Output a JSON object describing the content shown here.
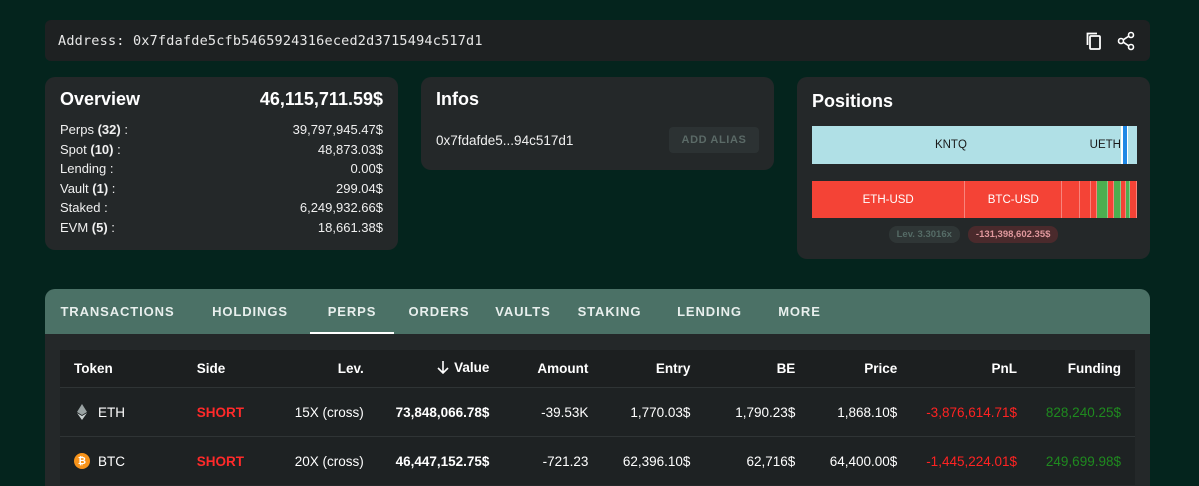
{
  "address_bar": {
    "text": "Address: 0x7fdafde5cfb5465924316eced2d3715494c517d1",
    "icons": [
      "copy-icon",
      "share-icon"
    ]
  },
  "overview": {
    "title": "Overview",
    "total": "46,115,711.59$",
    "rows": [
      {
        "label": "Perps",
        "count": "(32)",
        "suffix": " :",
        "value": "39,797,945.47$"
      },
      {
        "label": "Spot",
        "count": "(10)",
        "suffix": " :",
        "value": "48,873.03$"
      },
      {
        "label": "Lending :",
        "count": "",
        "suffix": "",
        "value": "0.00$"
      },
      {
        "label": "Vault",
        "count": "(1)",
        "suffix": " :",
        "value": "299.04$"
      },
      {
        "label": "Staked :",
        "count": "",
        "suffix": "",
        "value": "6,249,932.66$"
      },
      {
        "label": "EVM",
        "count": "(5)",
        "suffix": " :",
        "value": "18,661.38$"
      }
    ]
  },
  "infos": {
    "title": "Infos",
    "short_address": "0x7fdafde5...94c517d1",
    "alias_button": "ADD ALIAS"
  },
  "positions": {
    "title": "Positions",
    "spot_bar": [
      {
        "label": "KNTQ",
        "share": 0.855,
        "color": "#b0e0e6"
      },
      {
        "label": "UETH",
        "share": 0.095,
        "color": "#b0e0e6"
      },
      {
        "label": "",
        "share": 0.006,
        "color": "#ffffff"
      },
      {
        "label": "",
        "share": 0.012,
        "color": "#1e88e5"
      },
      {
        "label": "",
        "share": 0.004,
        "color": "#ffffff"
      },
      {
        "label": "",
        "share": 0.028,
        "color": "#b0e0e6"
      }
    ],
    "perp_bar": [
      {
        "label": "ETH-USD",
        "share": 0.472,
        "color": "#f44336"
      },
      {
        "label": "BTC-USD",
        "share": 0.298,
        "color": "#f44336"
      },
      {
        "label": "",
        "share": 0.054,
        "color": "#f44336"
      },
      {
        "label": "",
        "share": 0.034,
        "color": "#f44336"
      },
      {
        "label": "",
        "share": 0.018,
        "color": "#f44336"
      },
      {
        "label": "",
        "share": 0.034,
        "color": "#4caf50"
      },
      {
        "label": "",
        "share": 0.02,
        "color": "#f44336"
      },
      {
        "label": "",
        "share": 0.02,
        "color": "#4caf50"
      },
      {
        "label": "",
        "share": 0.016,
        "color": "#f44336"
      },
      {
        "label": "",
        "share": 0.012,
        "color": "#4caf50"
      },
      {
        "label": "",
        "share": 0.022,
        "color": "#f44336"
      }
    ],
    "leverage_badge": "Lev. 3.3016x",
    "pnl_badge": "-131,398,602.35$"
  },
  "tabs": [
    {
      "label": "TRANSACTIONS",
      "active": false
    },
    {
      "label": "HOLDINGS",
      "active": false
    },
    {
      "label": "PERPS",
      "active": true
    },
    {
      "label": "ORDERS",
      "active": false
    },
    {
      "label": "VAULTS",
      "active": false
    },
    {
      "label": "STAKING",
      "active": false
    },
    {
      "label": "LENDING",
      "active": false
    },
    {
      "label": "MORE",
      "active": false
    }
  ],
  "table": {
    "headers": {
      "token": "Token",
      "side": "Side",
      "lev": "Lev.",
      "value": "Value",
      "amount": "Amount",
      "entry": "Entry",
      "be": "BE",
      "price": "Price",
      "pnl": "PnL",
      "funding": "Funding"
    },
    "sort_icon": "arrow-down-icon",
    "rows": [
      {
        "token": "ETH",
        "icon": "eth-icon",
        "side": "SHORT",
        "lev": "15X (cross)",
        "value": "73,848,066.78$",
        "amount": "-39.53K",
        "entry": "1,770.03$",
        "be": "1,790.23$",
        "price": "1,868.10$",
        "pnl": "-3,876,614.71$",
        "funding": "828,240.25$"
      },
      {
        "token": "BTC",
        "icon": "btc-icon",
        "side": "SHORT",
        "lev": "20X (cross)",
        "value": "46,447,152.75$",
        "amount": "-721.23",
        "entry": "62,396.10$",
        "be": "62,716$",
        "price": "64,400.00$",
        "pnl": "-1,445,224.01$",
        "funding": "249,699.98$"
      }
    ]
  }
}
